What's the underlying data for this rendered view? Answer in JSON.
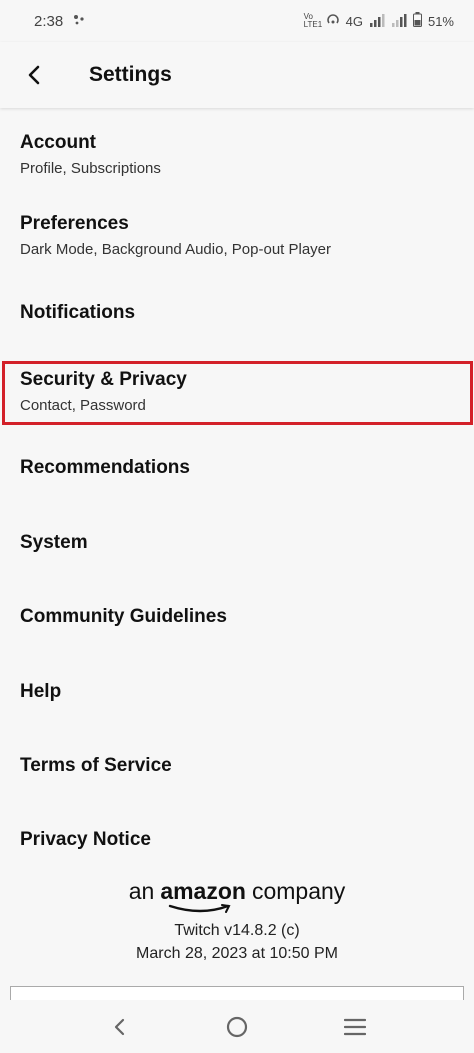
{
  "status_bar": {
    "time": "2:38",
    "network": "4G",
    "volte": "Vo LTE1",
    "battery": "51%"
  },
  "header": {
    "title": "Settings"
  },
  "settings": [
    {
      "label": "Account",
      "sub": "Profile, Subscriptions"
    },
    {
      "label": "Preferences",
      "sub": "Dark Mode, Background Audio, Pop-out Player"
    },
    {
      "label": "Notifications",
      "sub": ""
    },
    {
      "label": "Security & Privacy",
      "sub": "Contact, Password"
    },
    {
      "label": "Recommendations",
      "sub": ""
    },
    {
      "label": "System",
      "sub": ""
    },
    {
      "label": "Community Guidelines",
      "sub": ""
    },
    {
      "label": "Help",
      "sub": ""
    },
    {
      "label": "Terms of Service",
      "sub": ""
    },
    {
      "label": "Privacy Notice",
      "sub": ""
    }
  ],
  "footer": {
    "company_prefix": "an",
    "company_brand": "amazon",
    "company_suffix": "company",
    "version": "Twitch v14.8.2 (c)",
    "build_date": "March 28, 2023 at 10:50 PM"
  },
  "colors": {
    "highlight": "#d32029",
    "background": "#f7f7f7"
  }
}
